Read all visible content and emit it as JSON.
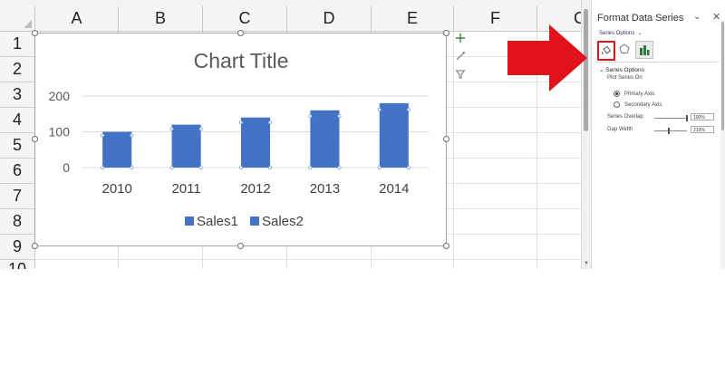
{
  "sheet": {
    "columns": [
      "A",
      "B",
      "C",
      "D",
      "E",
      "F",
      "C"
    ],
    "rows": [
      "1",
      "2",
      "3",
      "4",
      "5",
      "6",
      "7",
      "8",
      "9",
      "10"
    ]
  },
  "chart_data": {
    "type": "bar",
    "title": "Chart Title",
    "categories": [
      "2010",
      "2011",
      "2012",
      "2013",
      "2014"
    ],
    "series": [
      {
        "name": "Sales1",
        "values": [
          100,
          120,
          140,
          160,
          180
        ],
        "color": "#4472c4"
      },
      {
        "name": "Sales2",
        "values": [
          100,
          120,
          140,
          160,
          180
        ],
        "color": "#4472c4"
      }
    ],
    "y_ticks": [
      "0",
      "100",
      "200"
    ],
    "ylim": [
      0,
      200
    ],
    "grid": true,
    "legend_position": "bottom"
  },
  "chart_tools": {
    "add_element_icon": "plus-icon",
    "style_icon": "brush-icon",
    "filter_icon": "filter-icon"
  },
  "pane": {
    "title": "Format Data Series",
    "series_options_dropdown": "Series Options",
    "section_title": "Series Options",
    "plot_series_on": "Plot Series On",
    "primary_axis": "Primary Axis",
    "secondary_axis": "Secondary Axis",
    "series_overlap_label": "Series Overlap",
    "series_overlap_value": "100%",
    "series_overlap_level": 1.0,
    "gap_width_label": "Gap Width",
    "gap_width_value": "219%",
    "gap_width_level": 0.44,
    "tabs": [
      "fill-line-icon",
      "effects-icon",
      "series-options-icon"
    ]
  },
  "annotation": {
    "color": "#e0121c"
  }
}
